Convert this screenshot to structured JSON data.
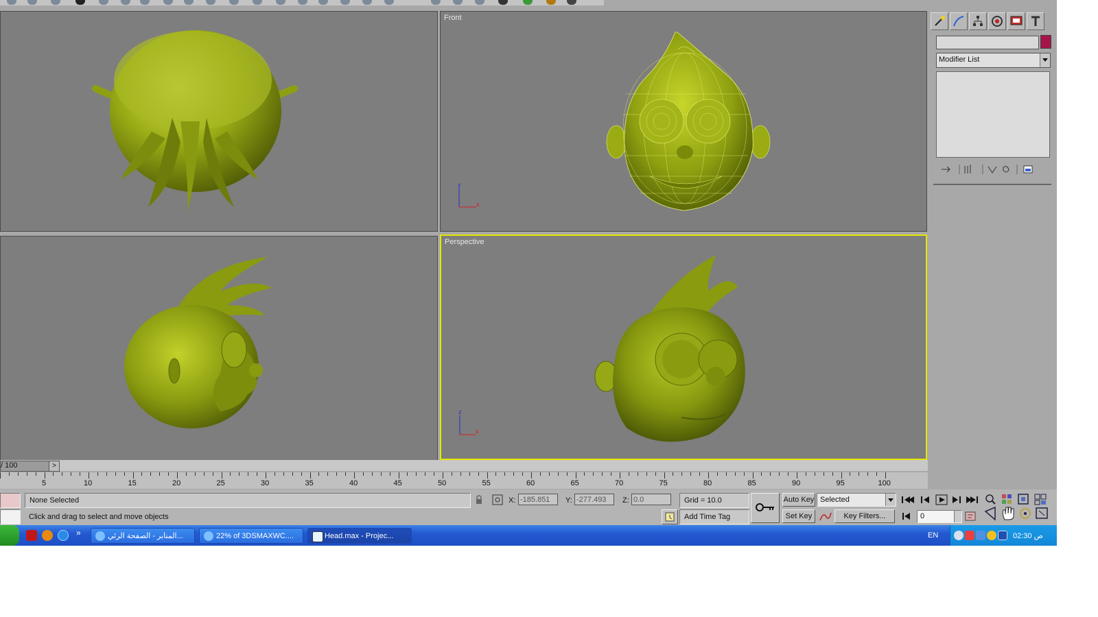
{
  "viewports": {
    "top_left": {
      "label": ""
    },
    "front": {
      "label": "Front"
    },
    "bottom_left": {
      "label": ""
    },
    "perspective": {
      "label": "Perspective"
    },
    "axis": {
      "z": "z",
      "x": "x"
    }
  },
  "command_panel": {
    "tabs": [
      "create-icon",
      "modify-icon",
      "hierarchy-icon",
      "motion-icon",
      "display-icon",
      "utilities-icon"
    ],
    "object_name": "",
    "object_color": "#a5154a",
    "modifier_list": "Modifier List"
  },
  "timeline": {
    "frame_counter": "/ 100",
    "next_label": ">",
    "ticks": [
      "5",
      "10",
      "15",
      "20",
      "25",
      "30",
      "35",
      "40",
      "45",
      "50",
      "55",
      "60",
      "65",
      "70",
      "75",
      "80",
      "85",
      "90",
      "95",
      "100"
    ]
  },
  "status": {
    "selection": "None Selected",
    "prompt": "Click and drag to select and move objects",
    "x_label": "X:",
    "x_value": "-185.851",
    "y_label": "Y:",
    "y_value": "-277.493",
    "z_label": "Z:",
    "z_value": "0.0",
    "grid": "Grid = 10.0",
    "add_time_tag": "Add Time Tag",
    "auto_key": "Auto Key",
    "key_mode": "Selected",
    "set_key": "Set Key",
    "key_filters": "Key Filters...",
    "current_frame": "0"
  },
  "taskbar": {
    "tasks": [
      {
        "label": "المنابر - الصفحة الرئي...",
        "icon": "ie-icon"
      },
      {
        "label": "22% of 3DSMAXWC....",
        "icon": "download-icon"
      },
      {
        "label": "Head.max    - Projec...",
        "icon": "3dsmax-icon"
      }
    ],
    "overflow": "»",
    "tray_lang": "EN",
    "clock": "02:30 ص"
  },
  "colors": {
    "viewport_bg": "#7e7e7e",
    "active_border": "#e6e600",
    "model_green": "#8a9a10"
  }
}
